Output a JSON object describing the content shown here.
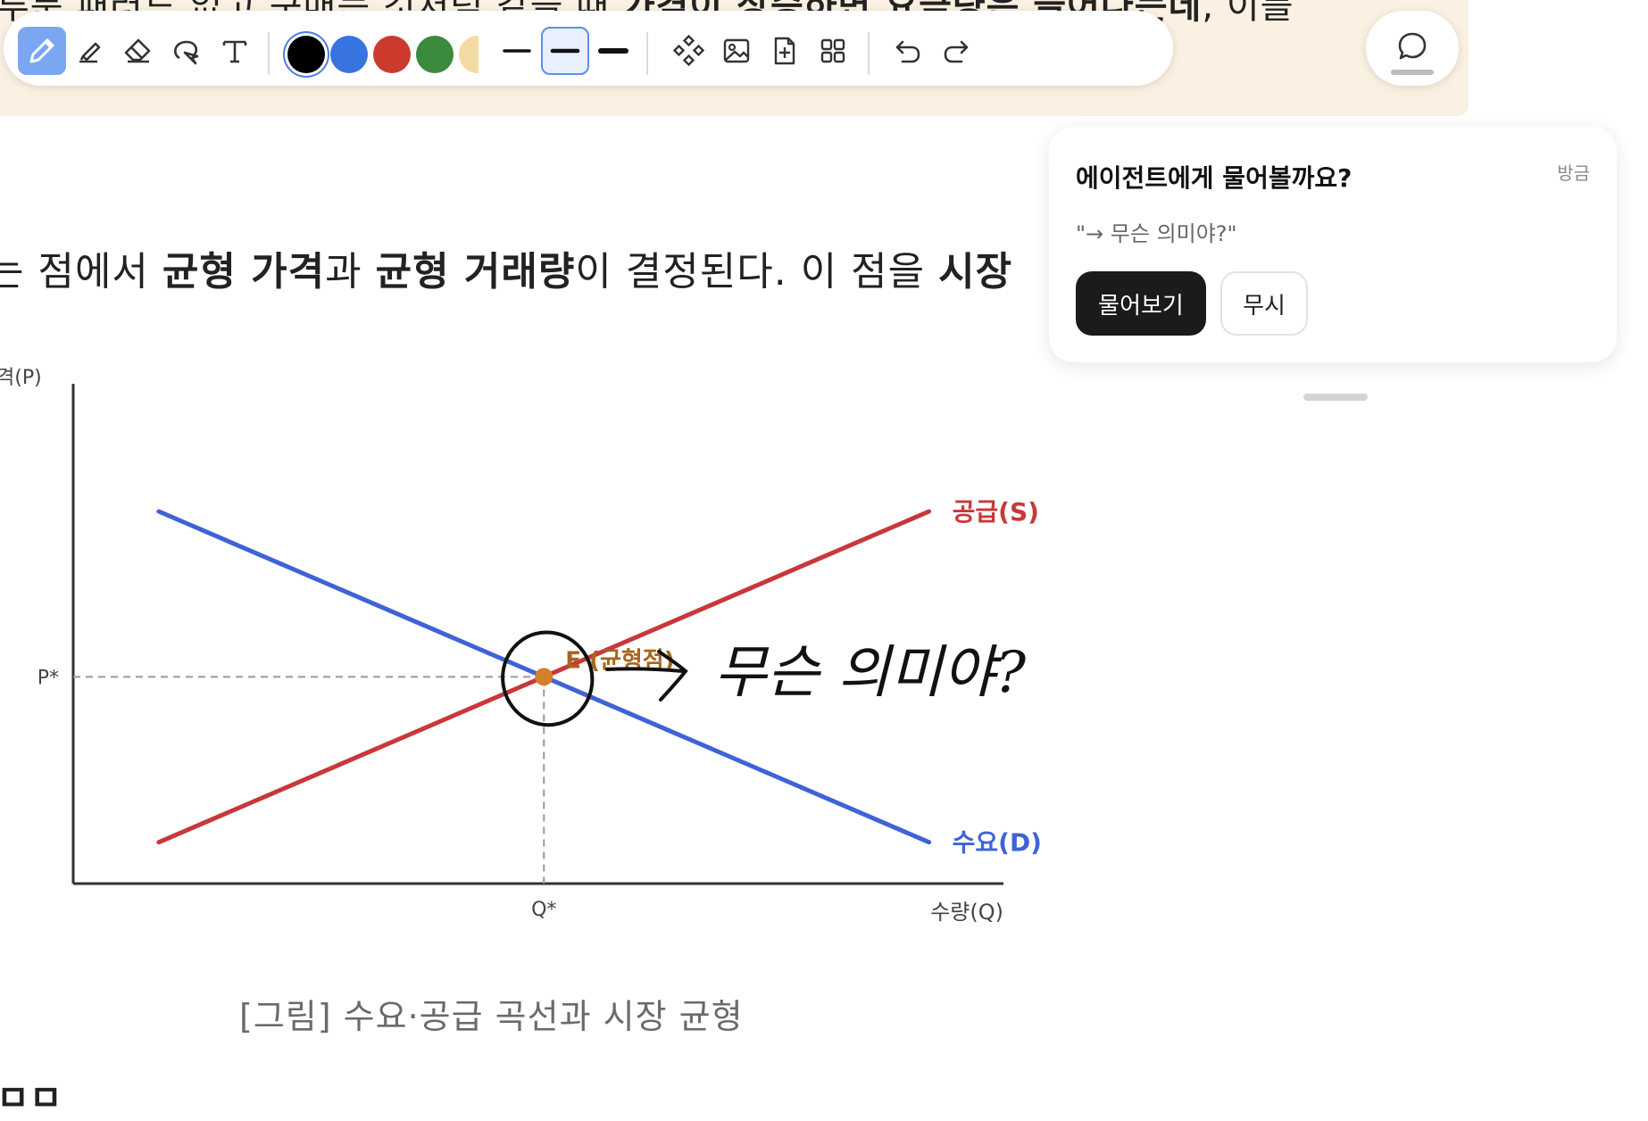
{
  "document": {
    "top_line_html_parts": [
      {
        "text": "루툼 패러드 없고 구매는 것처럼 같을 때 ",
        "bold": false
      },
      {
        "text": "가격이 상승하면 요금량은 늘어나는데",
        "bold": true
      },
      {
        "text": ", 이를",
        "bold": false
      }
    ],
    "paragraph_parts": [
      {
        "text": "는 점에서 ",
        "bold": false
      },
      {
        "text": "균형 가격",
        "bold": true
      },
      {
        "text": "과 ",
        "bold": false
      },
      {
        "text": "균형 거래량",
        "bold": true
      },
      {
        "text": "이 결정된다. 이 점을 ",
        "bold": false
      },
      {
        "text": "시장",
        "bold": true
      }
    ],
    "caption": "[그림] 수요·공급 곡선과 시장 균형",
    "bottom_fragment": "ㅁㅁ"
  },
  "toolbar": {
    "tools": [
      "pen-icon",
      "highlighter-icon",
      "eraser-icon",
      "lasso-icon",
      "text-icon"
    ],
    "colors": [
      "#000000",
      "#3874e0",
      "#cc3a2e",
      "#3b8a3e",
      "#f3d9a4"
    ],
    "selected_color": "#000000",
    "stroke_widths": [
      "thin",
      "medium",
      "thick"
    ],
    "selected_width": "medium",
    "actions": [
      "shapes-icon",
      "image-icon",
      "add-page-icon",
      "grid-icon",
      "undo-icon",
      "redo-icon"
    ]
  },
  "chart_data": {
    "type": "line",
    "title": "",
    "xlabel": "수량(Q)",
    "ylabel": "가격(P)",
    "xlim": [
      0,
      10
    ],
    "ylim": [
      0,
      10
    ],
    "series": [
      {
        "name": "공급(S)",
        "color": "#c8383a",
        "points": [
          [
            1,
            1
          ],
          [
            10,
            9
          ]
        ]
      },
      {
        "name": "수요(D)",
        "color": "#3e63d6",
        "points": [
          [
            1,
            9
          ],
          [
            10,
            1
          ]
        ]
      }
    ],
    "equilibrium": {
      "label": "E (균형점)",
      "x": 5.5,
      "y": 5,
      "color": "#d4802a"
    },
    "tick_labels": {
      "x": "Q*",
      "y": "P*"
    }
  },
  "annotation": {
    "handwritten": "→ 무슨 의미야?"
  },
  "popup": {
    "title": "에이전트에게 물어볼까요?",
    "time": "방금",
    "quote": "\"→ 무슨 의미야?\"",
    "ask_label": "물어보기",
    "ignore_label": "무시"
  }
}
